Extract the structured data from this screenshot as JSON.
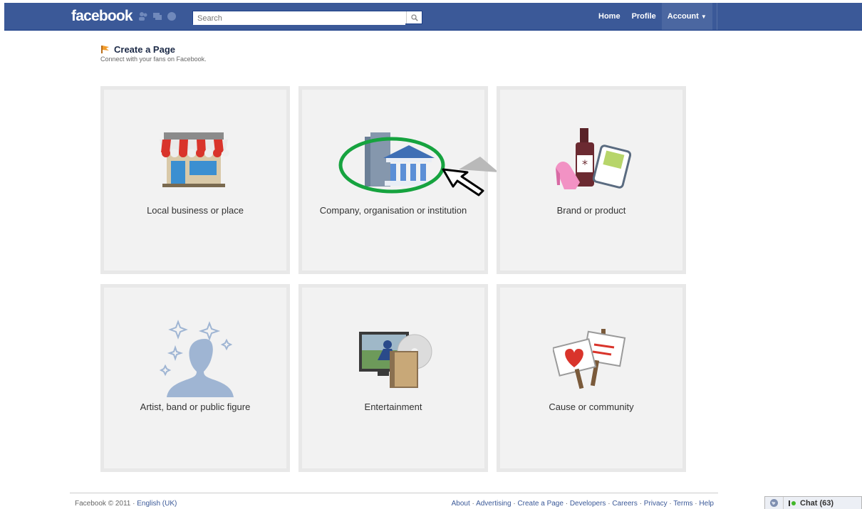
{
  "header": {
    "logo": "facebook",
    "search_placeholder": "Search",
    "nav": {
      "home": "Home",
      "profile": "Profile",
      "account": "Account"
    }
  },
  "page": {
    "title": "Create a Page",
    "subtitle": "Connect with your fans on Facebook."
  },
  "categories": [
    {
      "label": "Local business or place"
    },
    {
      "label": "Company, organisation or institution"
    },
    {
      "label": "Brand or product"
    },
    {
      "label": "Artist, band or public figure"
    },
    {
      "label": "Entertainment"
    },
    {
      "label": "Cause or community"
    }
  ],
  "footer": {
    "copyright": "Facebook © 2011 ·",
    "language": "English (UK)",
    "links": [
      "About",
      "Advertising",
      "Create a Page",
      "Developers",
      "Careers",
      "Privacy",
      "Terms",
      "Help"
    ]
  },
  "chat": {
    "label": "Chat (63)"
  },
  "colors": {
    "brand": "#3b5998",
    "highlight_circle": "#16a33f"
  }
}
